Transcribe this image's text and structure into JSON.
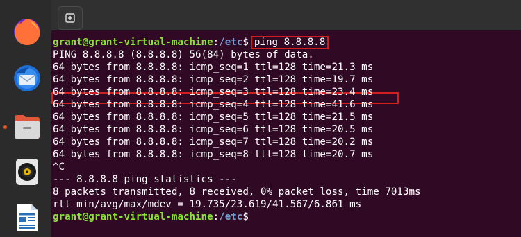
{
  "dock": {
    "apps": [
      {
        "name": "firefox-icon",
        "label": "Firefox"
      },
      {
        "name": "thunderbird-icon",
        "label": "Thunderbird"
      },
      {
        "name": "files-icon",
        "label": "Files"
      },
      {
        "name": "rhythmbox-icon",
        "label": "Rhythmbox"
      },
      {
        "name": "writer-icon",
        "label": "LibreOffice Writer"
      }
    ]
  },
  "terminal": {
    "prompt": {
      "user_host": "grant@grant-virtual-machine",
      "colon": ":",
      "path": "/etc",
      "symbol": "$"
    },
    "command": "ping 8.8.8.8",
    "output": [
      "PING 8.8.8.8 (8.8.8.8) 56(84) bytes of data.",
      "64 bytes from 8.8.8.8: icmp_seq=1 ttl=128 time=21.3 ms",
      "64 bytes from 8.8.8.8: icmp_seq=2 ttl=128 time=19.7 ms",
      "64 bytes from 8.8.8.8: icmp_seq=3 ttl=128 time=23.4 ms",
      "64 bytes from 8.8.8.8: icmp_seq=4 ttl=128 time=41.6 ms",
      "64 bytes from 8.8.8.8: icmp_seq=5 ttl=128 time=21.5 ms",
      "64 bytes from 8.8.8.8: icmp_seq=6 ttl=128 time=20.5 ms",
      "64 bytes from 8.8.8.8: icmp_seq=7 ttl=128 time=20.2 ms",
      "64 bytes from 8.8.8.8: icmp_seq=8 ttl=128 time=20.7 ms",
      "^C",
      "--- 8.8.8.8 ping statistics ---",
      "8 packets transmitted, 8 received, 0% packet loss, time 7013ms",
      "rtt min/avg/max/mdev = 19.735/23.619/41.567/6.861 ms"
    ]
  },
  "colors": {
    "terminal_bg": "#300a24",
    "prompt_user": "#8ae234",
    "prompt_path": "#729fcf",
    "highlight": "#d11f1f",
    "dock_active_dot": "#e95420"
  }
}
